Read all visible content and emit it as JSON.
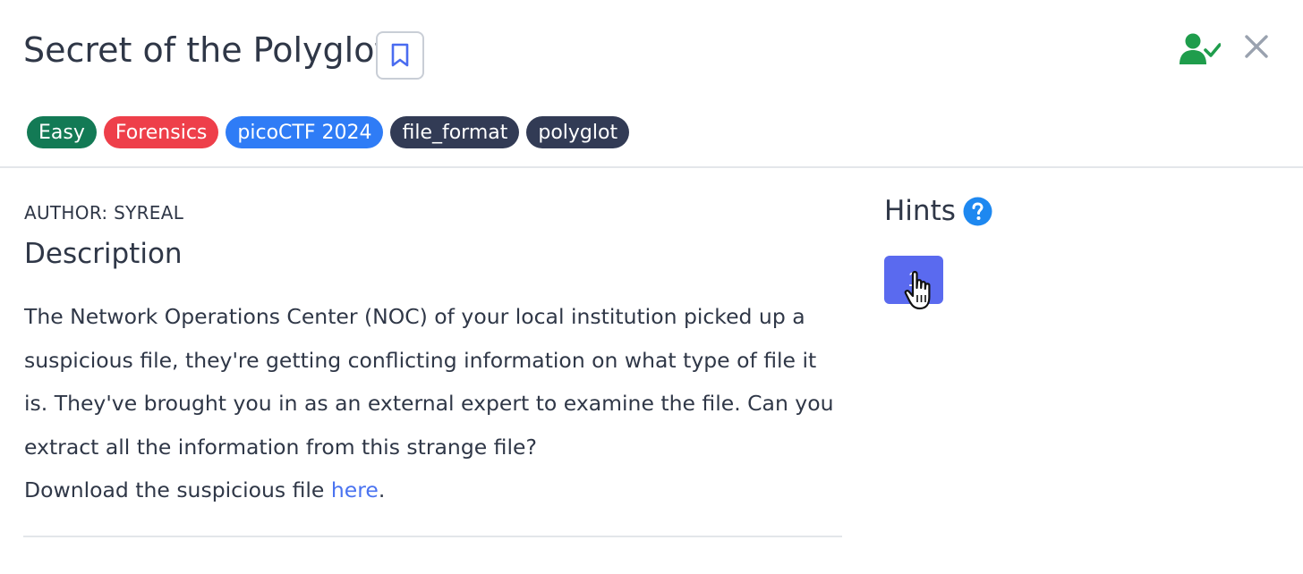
{
  "challenge": {
    "title": "Secret of the Polyglot",
    "tags": [
      {
        "label": "Easy",
        "color": "#137a55"
      },
      {
        "label": "Forensics",
        "color": "#ee3f4a"
      },
      {
        "label": "picoCTF 2024",
        "color": "#2f7cf6"
      },
      {
        "label": "file_format",
        "color": "#323b55"
      },
      {
        "label": "polyglot",
        "color": "#323b55"
      }
    ],
    "author": "AUTHOR: SYREAL",
    "description_heading": "Description",
    "description_text": "The Network Operations Center (NOC) of your local institution picked up a suspicious file, they're getting conflicting information on what type of file it is. They've brought you in as an external expert to examine the file. Can you extract all the information from this strange file?",
    "download_prefix": "Download the suspicious file ",
    "download_link": "here",
    "download_suffix": "."
  },
  "hints": {
    "title": "Hints",
    "items": [
      {
        "label": "1"
      }
    ]
  },
  "icons": {
    "bookmark": "bookmark-icon",
    "solved": "user-check-icon",
    "close": "close-icon",
    "help": "question-circle-icon"
  },
  "colors": {
    "solved_green": "#1f9d4c",
    "hint_button": "#5a6aef",
    "link": "#4a73f0",
    "help_blue": "#1e88f0"
  }
}
